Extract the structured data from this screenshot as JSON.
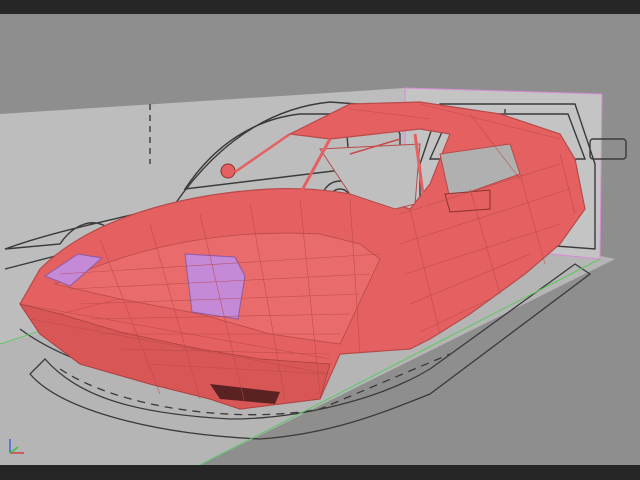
{
  "viewport": {
    "label": "",
    "background_color": "#8e8e8e",
    "frame_color": "#262626"
  },
  "scene": {
    "model": "wireframe-car-body",
    "model_color": "#e56060",
    "highlight_color": "#c48ad8",
    "blueprint_color": "#b9b9b9",
    "grid_color": "#5ec85e"
  },
  "axis_gizmo": {
    "x_color": "#d04040",
    "y_color": "#40c040",
    "z_color": "#4060e0"
  }
}
